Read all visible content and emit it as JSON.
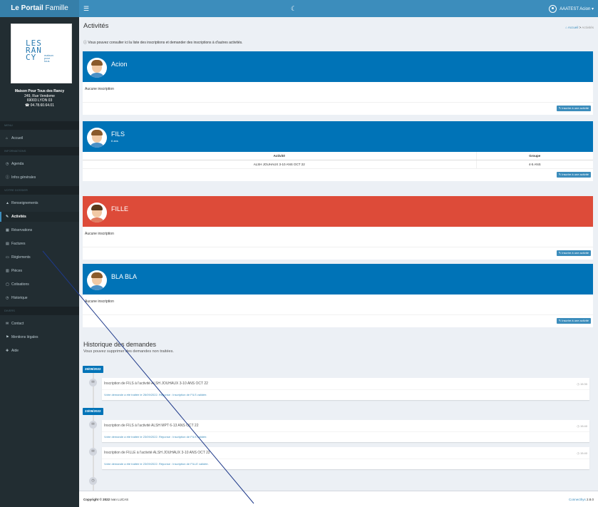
{
  "header": {
    "logo_bold": "Le Portail",
    "logo_light": " Famille",
    "menu_icon": "☰",
    "theme_icon": "☾",
    "user_label": "AAATEST Acion ▾"
  },
  "sidebar": {
    "logo_text": "LES\nRAN\nCY",
    "logo_tag": "maison\npour\ntous",
    "org_name": "Maison Pour Tous des Rancy",
    "org_address": "249, Rue Vendome",
    "org_city": "69003 LYON 03",
    "org_phone": "☎ 04.78.60.64.01",
    "sections": [
      "MENU",
      "INFORMATIONS",
      "VOTRE DOSSIER",
      "DIVERS"
    ],
    "items": [
      {
        "icon": "⌂",
        "label": "Accueil"
      },
      {
        "icon": "◷",
        "label": "Agenda"
      },
      {
        "icon": "ⓘ",
        "label": "Infos générales"
      },
      {
        "icon": "▲",
        "label": "Renseignements"
      },
      {
        "icon": "✎",
        "label": "Activités"
      },
      {
        "icon": "▦",
        "label": "Réservations"
      },
      {
        "icon": "▤",
        "label": "Factures"
      },
      {
        "icon": "▭",
        "label": "Règlements"
      },
      {
        "icon": "▥",
        "label": "Pièces"
      },
      {
        "icon": "▢",
        "label": "Cotisations"
      },
      {
        "icon": "◷",
        "label": "Historique"
      },
      {
        "icon": "✉",
        "label": "Contact"
      },
      {
        "icon": "⚑",
        "label": "Mentions légales"
      },
      {
        "icon": "✚",
        "label": "Aide"
      }
    ]
  },
  "page": {
    "title": "Activités",
    "breadcrumb_home": "Accueil",
    "breadcrumb_sep": " > ",
    "breadcrumb_current": "Activités",
    "intro": "Vous pouvez consulter ici la liste des inscriptions et demander des inscriptions à d'autres activités."
  },
  "members": [
    {
      "name": "Acion",
      "sub": "",
      "empty": "Aucune inscription",
      "button": "Inscrire à une activité"
    },
    {
      "name": "FILS",
      "sub": "6 ans",
      "button": "Inscrire à une activité",
      "table": {
        "headers": [
          "Activité",
          "Groupe"
        ],
        "rows": [
          [
            "ALSH JOUHAUX 3-10 ANS OCT 22",
            "4-5 ANS"
          ]
        ]
      }
    },
    {
      "name": "FILLE",
      "sub": "",
      "empty": "Aucune inscription",
      "button": "Inscrire à une activité"
    },
    {
      "name": "BLA BLA",
      "sub": "",
      "empty": "Aucune inscription",
      "button": "Inscrire à une activité"
    }
  ],
  "history": {
    "title": "Historique des demandes",
    "subtitle": "Vous pouvez supprimer des demandes non traitées.",
    "dates": [
      "26/09/2022",
      "23/09/2022"
    ],
    "entries": [
      {
        "title": "Inscription de FILS à l'activité ALSH JOUHAUX 3-10 ANS OCT 22",
        "time": "◷ 15:30",
        "body": "Votre demande a été traitée le 26/09/2022. Réponse : Inscription de FILS validée."
      },
      {
        "title": "Inscription de FILS à l'activité ALSH MPT 6-13 ANS OCT 22",
        "time": "◷ 15:40",
        "body": "Votre demande a été traitée le 23/09/2022. Réponse : Inscription de FILS validée."
      },
      {
        "title": "Inscription de FILLE à l'activité ALSH JOUHAUX 3-10 ANS OCT 22",
        "time": "◷ 15:40",
        "body": "Votre demande a été traitée le 23/09/2022. Réponse : Inscription de FILLE validée."
      }
    ]
  },
  "footer": {
    "copyright_bold": "Copyright © 2022",
    "copyright_name": " Ivan LUCAS",
    "product": "Connecthys",
    "version": " 2.8.0"
  }
}
